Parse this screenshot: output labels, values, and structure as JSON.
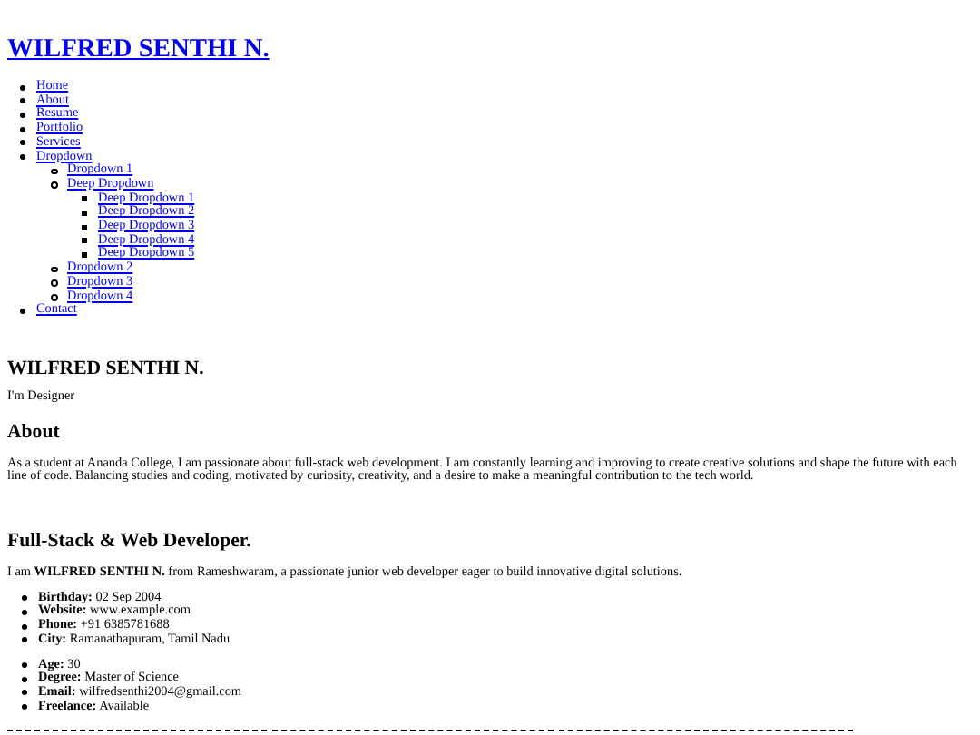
{
  "site_title": "WILFRED SENTHI N.",
  "nav": [
    {
      "label": "Home"
    },
    {
      "label": "About"
    },
    {
      "label": "Resume"
    },
    {
      "label": "Portfolio"
    },
    {
      "label": "Services"
    },
    {
      "label": "Dropdown",
      "children": [
        {
          "label": "Dropdown 1"
        },
        {
          "label": "Deep Dropdown",
          "children": [
            {
              "label": "Deep Dropdown 1"
            },
            {
              "label": "Deep Dropdown 2"
            },
            {
              "label": "Deep Dropdown 3"
            },
            {
              "label": "Deep Dropdown 4"
            },
            {
              "label": "Deep Dropdown 5"
            }
          ]
        },
        {
          "label": "Dropdown 2"
        },
        {
          "label": "Dropdown 3"
        },
        {
          "label": "Dropdown 4"
        }
      ]
    },
    {
      "label": "Contact"
    }
  ],
  "hero": {
    "name": "WILFRED SENTHI N.",
    "tagline": "I'm Designer"
  },
  "about": {
    "heading": "About",
    "text": "As a student at Ananda College, I am passionate about full-stack web development. I am constantly learning and improving to create creative solutions and shape the future with each line of code. Balancing studies and coding, motivated by curiosity, creativity, and a desire to make a meaningful contribution to the tech world."
  },
  "profile": {
    "heading": "Full-Stack & Web Developer.",
    "intro": "I am **WILFRED SENTHI N.** from Rameshwaram, a passionate junior web developer eager to build innovative digital solutions.",
    "lists": [
      [
        {
          "label": "Birthday:",
          "value": "02 Sep 2004"
        },
        {
          "label": "Website:",
          "value": "www.example.com"
        },
        {
          "label": "Phone:",
          "value": "+91 6385781688"
        },
        {
          "label": "City:",
          "value": "Ramanathapuram, Tamil Nadu"
        }
      ],
      [
        {
          "label": "Age:",
          "value": "30"
        },
        {
          "label": "Degree:",
          "value": "Master of Science"
        },
        {
          "label": "Email:",
          "value": "wilfredsenthi2004@gmail.com"
        },
        {
          "label": "Freelance:",
          "value": "Available"
        }
      ]
    ]
  }
}
